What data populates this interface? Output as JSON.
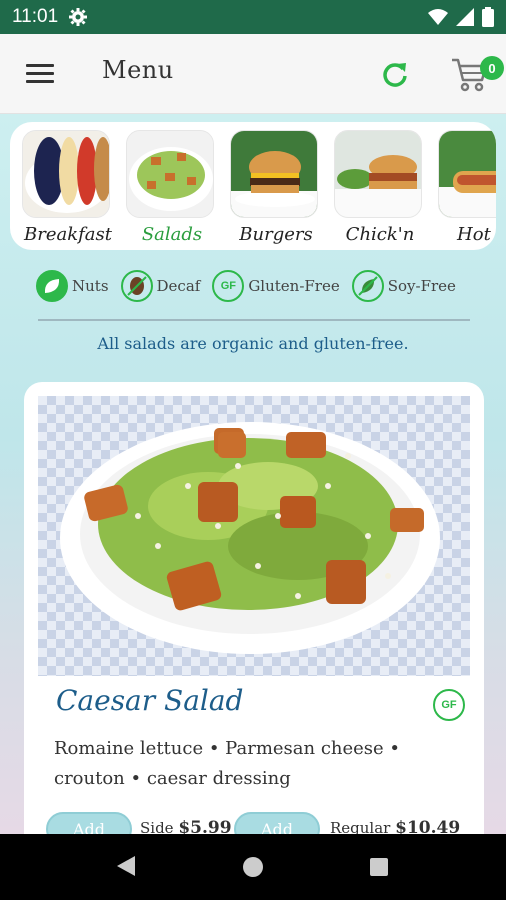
{
  "status": {
    "time": "11:01"
  },
  "header": {
    "title": "Menu",
    "cart_count": "0"
  },
  "categories": [
    {
      "label": "Breakfast",
      "active": false
    },
    {
      "label": "Salads",
      "active": true
    },
    {
      "label": "Burgers",
      "active": false
    },
    {
      "label": "Chick'n",
      "active": false
    },
    {
      "label": "Hot D",
      "active": false
    }
  ],
  "legend": [
    {
      "label": "Nuts",
      "icon": "nuts-icon"
    },
    {
      "label": "Decaf",
      "icon": "decaf-icon"
    },
    {
      "label": "Gluten-Free",
      "icon": "gluten-free-icon",
      "abbr": "GF"
    },
    {
      "label": "Soy-Free",
      "icon": "soy-free-icon"
    }
  ],
  "note": "All salads are organic and gluten-free.",
  "item": {
    "name": "Caesar Salad",
    "badge": "GF",
    "ingredients": "Romaine lettuce • Parmesan cheese • crouton • caesar dressing",
    "options": [
      {
        "button": "Add",
        "label": "Side",
        "price": "$5.99"
      },
      {
        "button": "Add",
        "label": "Regular",
        "price": "$10.49"
      }
    ]
  },
  "colors": {
    "primary": "#1f6a4a",
    "accent": "#2db84a",
    "title_blue": "#1d5d8a"
  }
}
